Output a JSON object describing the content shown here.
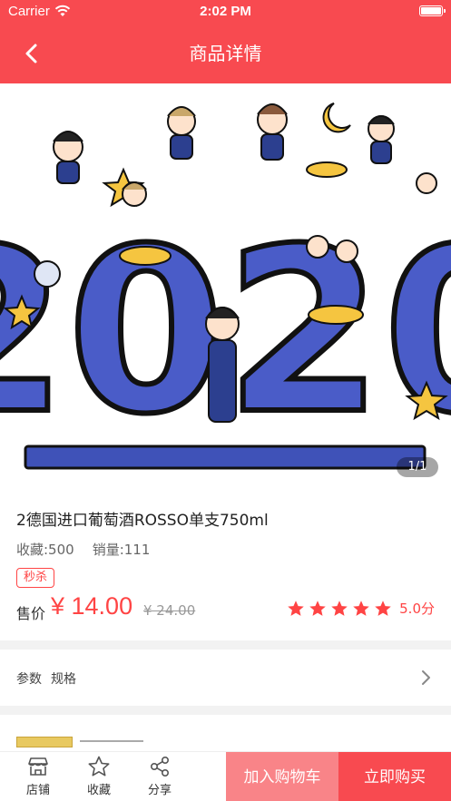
{
  "status_bar": {
    "carrier": "Carrier",
    "time": "2:02 PM"
  },
  "nav": {
    "title": "商品详情",
    "back_icon": "chevron-left-icon"
  },
  "banner": {
    "artwork_text": "2020",
    "page_indicator": "1/1"
  },
  "product": {
    "title": "2德国进口葡萄酒ROSSO单支750ml",
    "favorites": "收藏:500",
    "sales": "销量:111",
    "tag": "秒杀",
    "price_label": "售价",
    "price": "¥ 14.00",
    "original_price": "¥ 24.00",
    "rating_stars": 5,
    "rating_text": "5.0分"
  },
  "params": {
    "label1": "参数",
    "label2": "规格"
  },
  "bottom": {
    "store_label": "店铺",
    "favorite_label": "收藏",
    "share_label": "分享",
    "add_cart_label": "加入购物车",
    "buy_now_label": "立即购买"
  },
  "colors": {
    "brand": "#f84a50",
    "brand_light": "#f98488",
    "accent_blue": "#4a5cc8"
  }
}
